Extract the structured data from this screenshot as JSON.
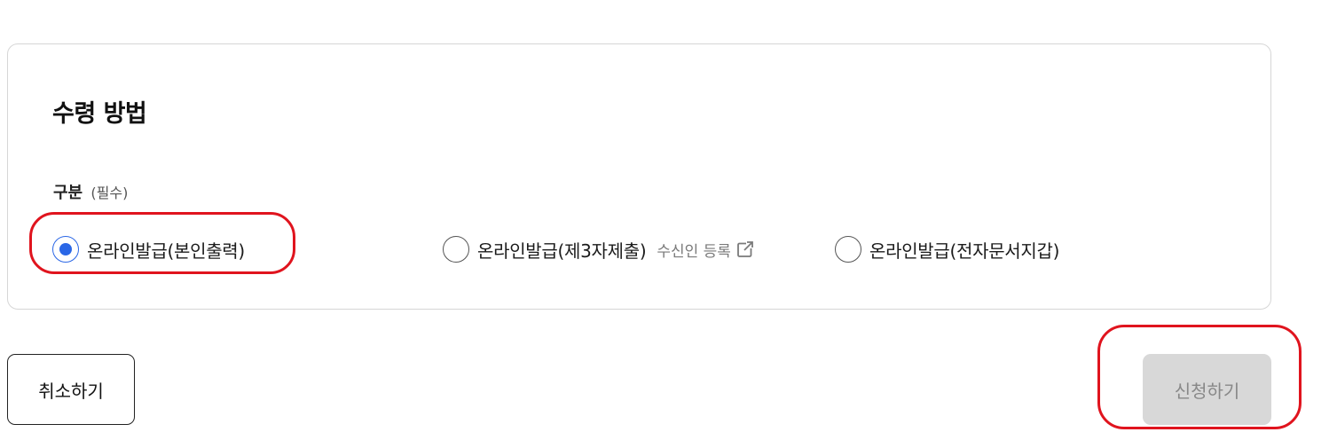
{
  "section": {
    "title": "수령 방법",
    "field_label": "구분",
    "field_required": "(필수)"
  },
  "options": [
    {
      "label": "온라인발급(본인출력)",
      "selected": true
    },
    {
      "label": "온라인발급(제3자제출)",
      "selected": false,
      "link_label": "수신인 등록",
      "link_icon": "external-link-icon"
    },
    {
      "label": "온라인발급(전자문서지갑)",
      "selected": false
    }
  ],
  "buttons": {
    "cancel": "취소하기",
    "submit": "신청하기"
  },
  "colors": {
    "accent": "#2b67e6",
    "annotation": "#e0141e",
    "disabled_button_bg": "#d8d8d8"
  }
}
